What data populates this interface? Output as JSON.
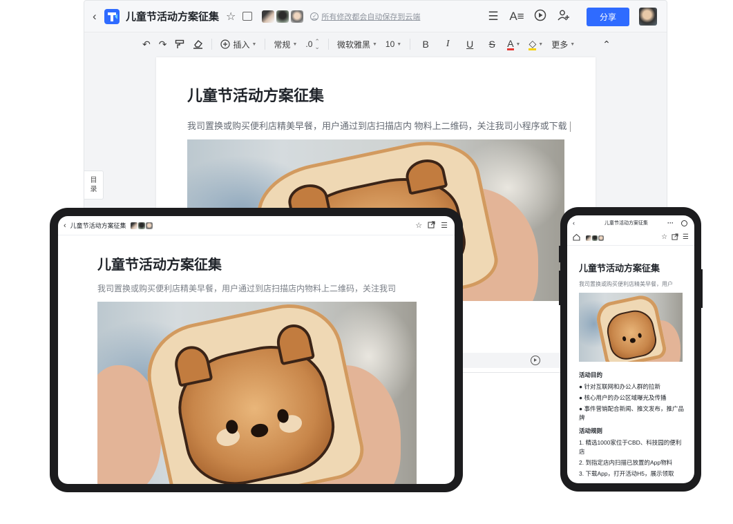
{
  "doc": {
    "title": "儿童节活动方案征集",
    "paragraph_desktop": "我司置换或购买便利店精美早餐，用户通过到店扫描店内 物料上二维码，关注我司小程序或下载",
    "paragraph_tablet": "我司置换或购买便利店精美早餐，用户通过到店扫描店内物料上二维码，关注我司",
    "paragraph_phone": "我司置换或购买便利店精美早餐，用户"
  },
  "header": {
    "back_icon": "‹",
    "star_icon": "☆",
    "autosave_text": "所有修改都会自动保存到云端",
    "share_label": "分享",
    "menu_icon": "☰",
    "font_icon": "A≡",
    "present_icon": "▶",
    "add_user_icon": "+"
  },
  "toolbar": {
    "undo": "↶",
    "redo": "↷",
    "format_painter": "⟟",
    "eraser": "⌫",
    "insert_label": "插入",
    "style_label": "常规",
    "spacing_label": ".0",
    "font_label": "微软雅黑",
    "size_label": "10",
    "bold": "B",
    "italic": "I",
    "underline": "U",
    "strike": "S",
    "font_color": "A",
    "highlight": "◇",
    "more_label": "更多",
    "collapse": "⌃"
  },
  "sidebar": {
    "toc_char1": "目",
    "toc_char2": "录"
  },
  "phone": {
    "section1_title": "活动目的",
    "section1_items": [
      "● 针对互联网和办公人群的拉新",
      "● 核心用户的办公区域曝光及传播",
      "● 事件营销配合新闻、推文发布，推广品牌"
    ],
    "section2_title": "活动规则",
    "section2_items": [
      "1. 精选1000家位于CBD、科技园的便利店",
      "2. 到指定店内扫描已放置的App物料",
      "3. 下载App，打开活动H5，展示领取"
    ]
  },
  "colors": {
    "accent": "#2f6bff",
    "font_color_underline": "#e53935",
    "highlight_underline": "#f5d000",
    "title_text": "#1f2329",
    "secondary_text": "#646a73"
  }
}
